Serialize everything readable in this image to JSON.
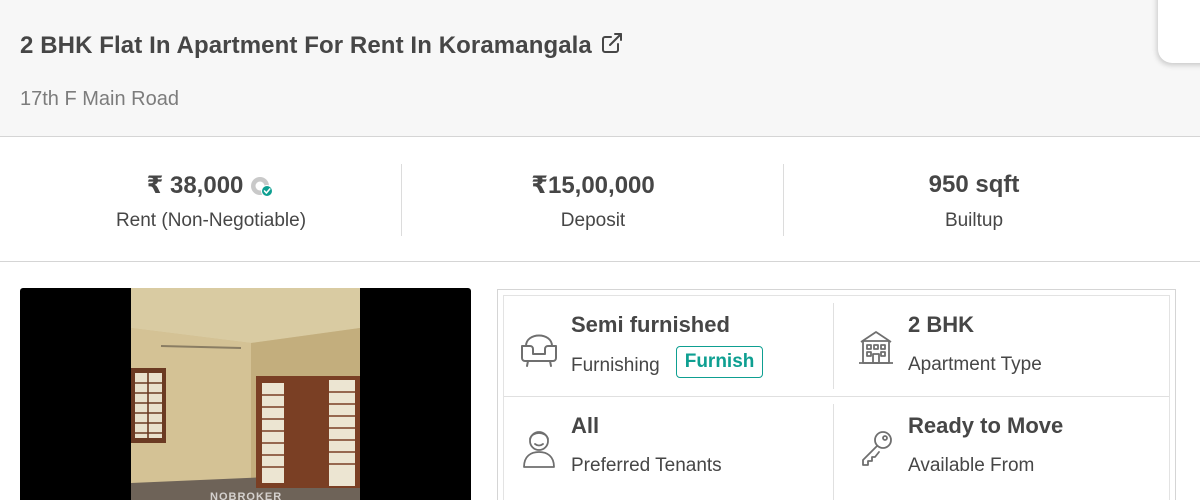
{
  "header": {
    "title": "2 BHK Flat In Apartment For Rent In Koramangala",
    "subtitle": "17th F Main Road",
    "external_link_icon": "external-link-icon"
  },
  "stats": [
    {
      "value": "₹ 38,000",
      "label": "Rent (Non-Negotiable)",
      "icon": "verified-badge-icon"
    },
    {
      "value": "₹15,00,000",
      "label": "Deposit"
    },
    {
      "value": "950 sqft",
      "label": "Builtup"
    }
  ],
  "photo": {
    "watermark": "NOBROKER"
  },
  "details": {
    "furnishing": {
      "value": "Semi furnished",
      "label": "Furnishing",
      "button": "Furnish",
      "icon": "armchair-icon"
    },
    "apartment_type": {
      "value": "2 BHK",
      "label": "Apartment Type",
      "icon": "building-icon"
    },
    "preferred_tenants": {
      "value": "All",
      "label": "Preferred Tenants",
      "icon": "person-icon"
    },
    "available_from": {
      "value": "Ready to Move",
      "label": "Available From",
      "icon": "key-icon"
    }
  },
  "colors": {
    "accent": "#0e9f91",
    "text": "#464646",
    "muted": "#7c7c7c",
    "header_bg": "#f7f7f7"
  }
}
